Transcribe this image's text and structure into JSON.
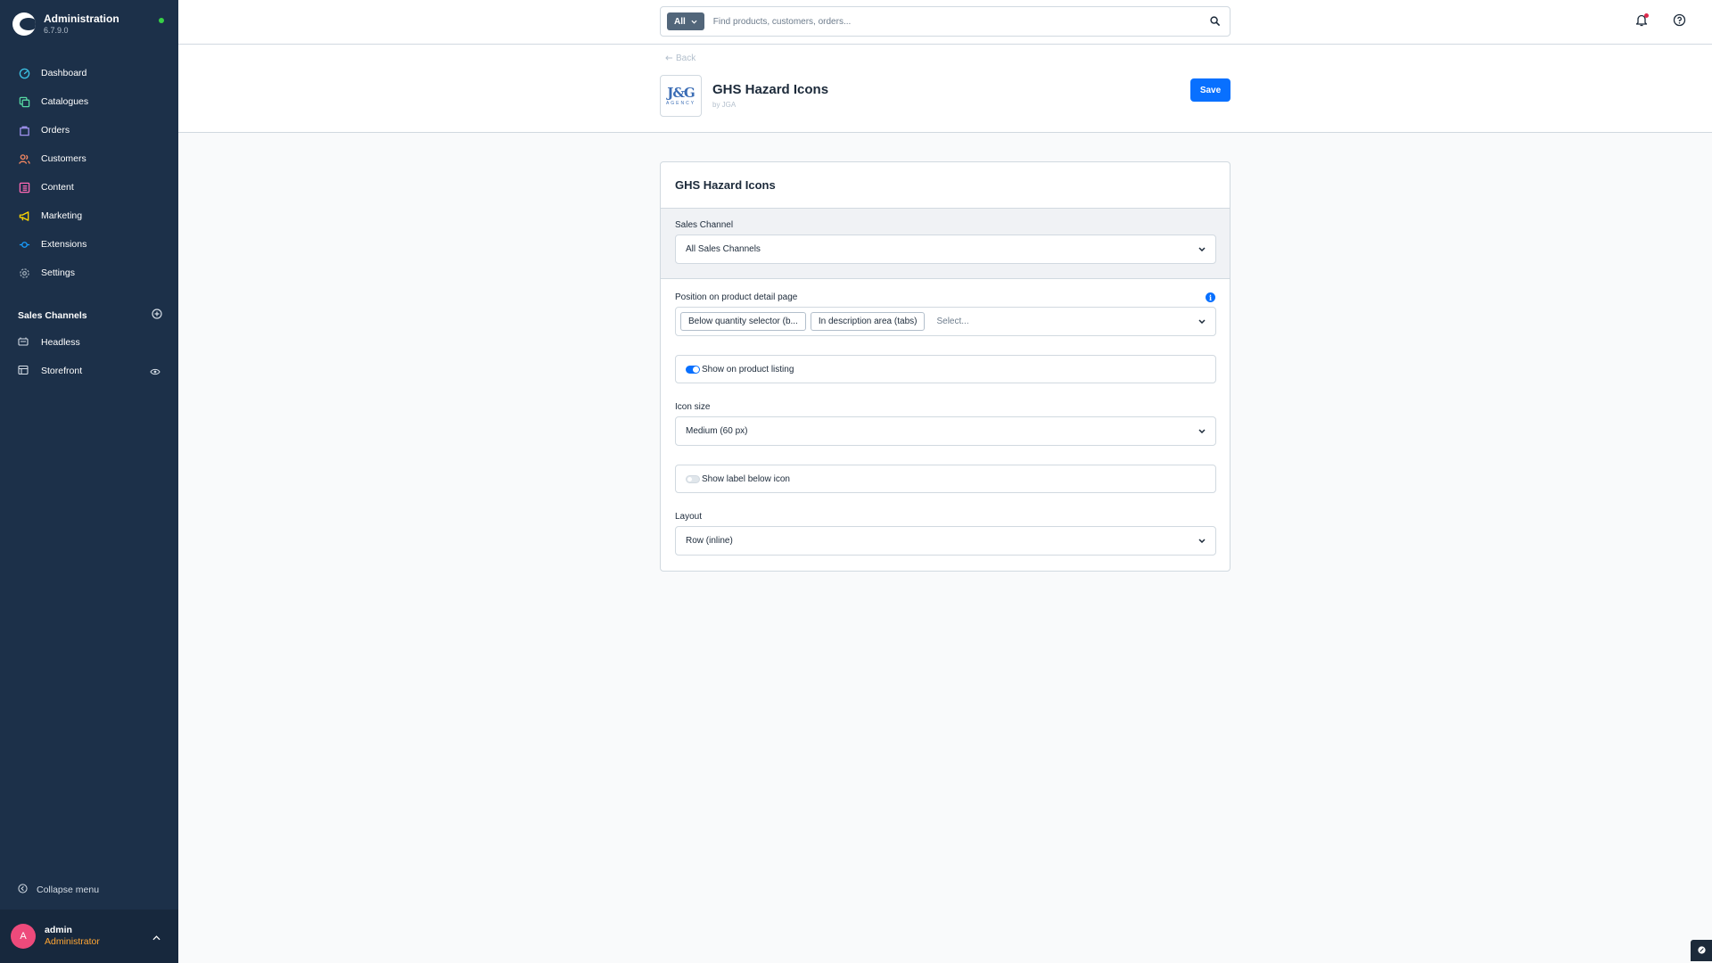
{
  "app": {
    "title": "Administration",
    "version": "6.7.9.0"
  },
  "nav": {
    "items": [
      {
        "label": "Dashboard",
        "icon": "dashboard-icon",
        "color": "#3cc3e6"
      },
      {
        "label": "Catalogues",
        "icon": "catalogue-icon",
        "color": "#57d9a3"
      },
      {
        "label": "Orders",
        "icon": "orders-icon",
        "color": "#a092f0"
      },
      {
        "label": "Customers",
        "icon": "customers-icon",
        "color": "#f88962"
      },
      {
        "label": "Content",
        "icon": "content-icon",
        "color": "#ff68b4"
      },
      {
        "label": "Marketing",
        "icon": "marketing-icon",
        "color": "#ffd700"
      },
      {
        "label": "Extensions",
        "icon": "extensions-icon",
        "color": "#189eff"
      },
      {
        "label": "Settings",
        "icon": "settings-icon",
        "color": "#9aa8b5"
      }
    ]
  },
  "sales_channels": {
    "title": "Sales Channels",
    "items": [
      {
        "label": "Headless",
        "icon": "headless-icon"
      },
      {
        "label": "Storefront",
        "icon": "storefront-icon"
      }
    ]
  },
  "collapse_label": "Collapse menu",
  "user": {
    "initial": "A",
    "name": "admin",
    "role": "Administrator"
  },
  "search": {
    "type_label": "All",
    "placeholder": "Find products, customers, orders..."
  },
  "header": {
    "back_label": "Back",
    "extension_title": "GHS Hazard Icons",
    "extension_by": "by JGA",
    "logo_text": "J&G",
    "logo_subtext": "AGENCY",
    "save_label": "Save"
  },
  "card": {
    "title": "GHS Hazard Icons",
    "sales_channel": {
      "label": "Sales Channel",
      "value": "All Sales Channels"
    },
    "position": {
      "label": "Position on product detail page",
      "chips": [
        "Below quantity selector (b...",
        "In description area (tabs)"
      ],
      "placeholder": "Select..."
    },
    "show_on_listing": {
      "label": "Show on product listing",
      "enabled": true
    },
    "icon_size": {
      "label": "Icon size",
      "value": "Medium (60 px)"
    },
    "show_label": {
      "label": "Show label below icon",
      "enabled": false
    },
    "layout": {
      "label": "Layout",
      "value": "Row (inline)"
    }
  },
  "colors": {
    "sidebar_bg": "#1c3049",
    "primary": "#0870ff",
    "status_online": "#37d046",
    "role": "#ffa634",
    "avatar": "#ed4a7b"
  }
}
